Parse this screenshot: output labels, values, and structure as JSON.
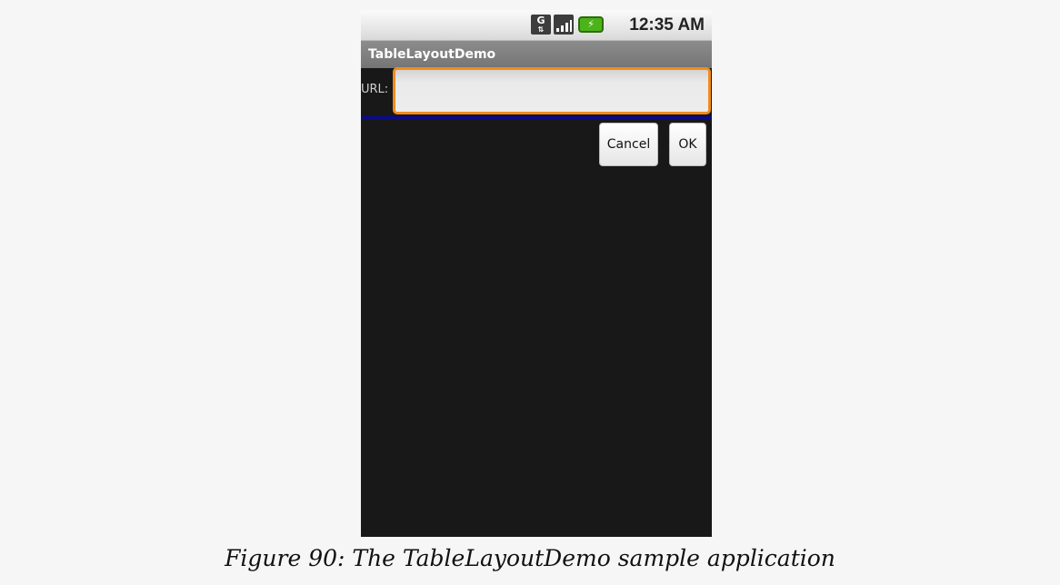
{
  "status_bar": {
    "time": "12:35 AM",
    "network_label": "G",
    "network_arrows": "⇅",
    "icons": [
      "network-type-icon",
      "signal-strength-icon",
      "battery-charging-icon"
    ]
  },
  "app": {
    "title": "TableLayoutDemo"
  },
  "form": {
    "url_label": "URL:",
    "url_value": "",
    "cancel_label": "Cancel",
    "ok_label": "OK"
  },
  "colors": {
    "focus_border": "#f08c1e",
    "divider": "#0a0a8c",
    "screen_background": "#181818",
    "battery": "#4cb319"
  },
  "caption": "Figure 90: The TableLayoutDemo sample application"
}
